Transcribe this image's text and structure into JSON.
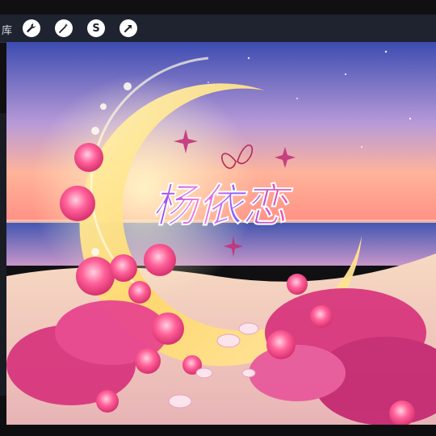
{
  "toolbar": {
    "label": "库",
    "buttons": [
      {
        "name": "wrench-icon",
        "glyph": ""
      },
      {
        "name": "wand-icon",
        "glyph": ""
      },
      {
        "name": "s-tool-icon",
        "glyph": "S"
      },
      {
        "name": "arrow-icon",
        "glyph": ""
      }
    ]
  },
  "artwork": {
    "signature_text": "杨依恋",
    "scene": "crescent-moon-beach-roses",
    "colors": {
      "sky_top": "#3c4cb0",
      "sky_mid": "#b89ad8",
      "horizon": "#ff9f8a",
      "sea": "#4a5fb8",
      "sand": "#f3c9b2",
      "moon_gold": "#ffe38a",
      "rose_pink": "#ff4f8f"
    }
  }
}
